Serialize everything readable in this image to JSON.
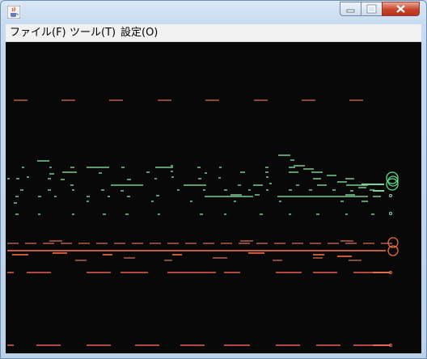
{
  "window": {
    "title": "",
    "icon": "java-coffee-cup-icon"
  },
  "menu": [
    {
      "label": "ファイル(F)",
      "name": "menu-file"
    },
    {
      "label": "ツール(T)",
      "name": "menu-tool"
    },
    {
      "label": "設定(O)",
      "name": "menu-settings"
    }
  ],
  "colors": {
    "background": "#080808",
    "green_track": "#5e9a6e",
    "green_light": "#7fd29a",
    "orange_track": "#c85a34",
    "red_track": "#b0483c",
    "brown_track": "#8a4a38",
    "ring_green": "#58e08a",
    "ring_orange": "#ee6a3c"
  }
}
